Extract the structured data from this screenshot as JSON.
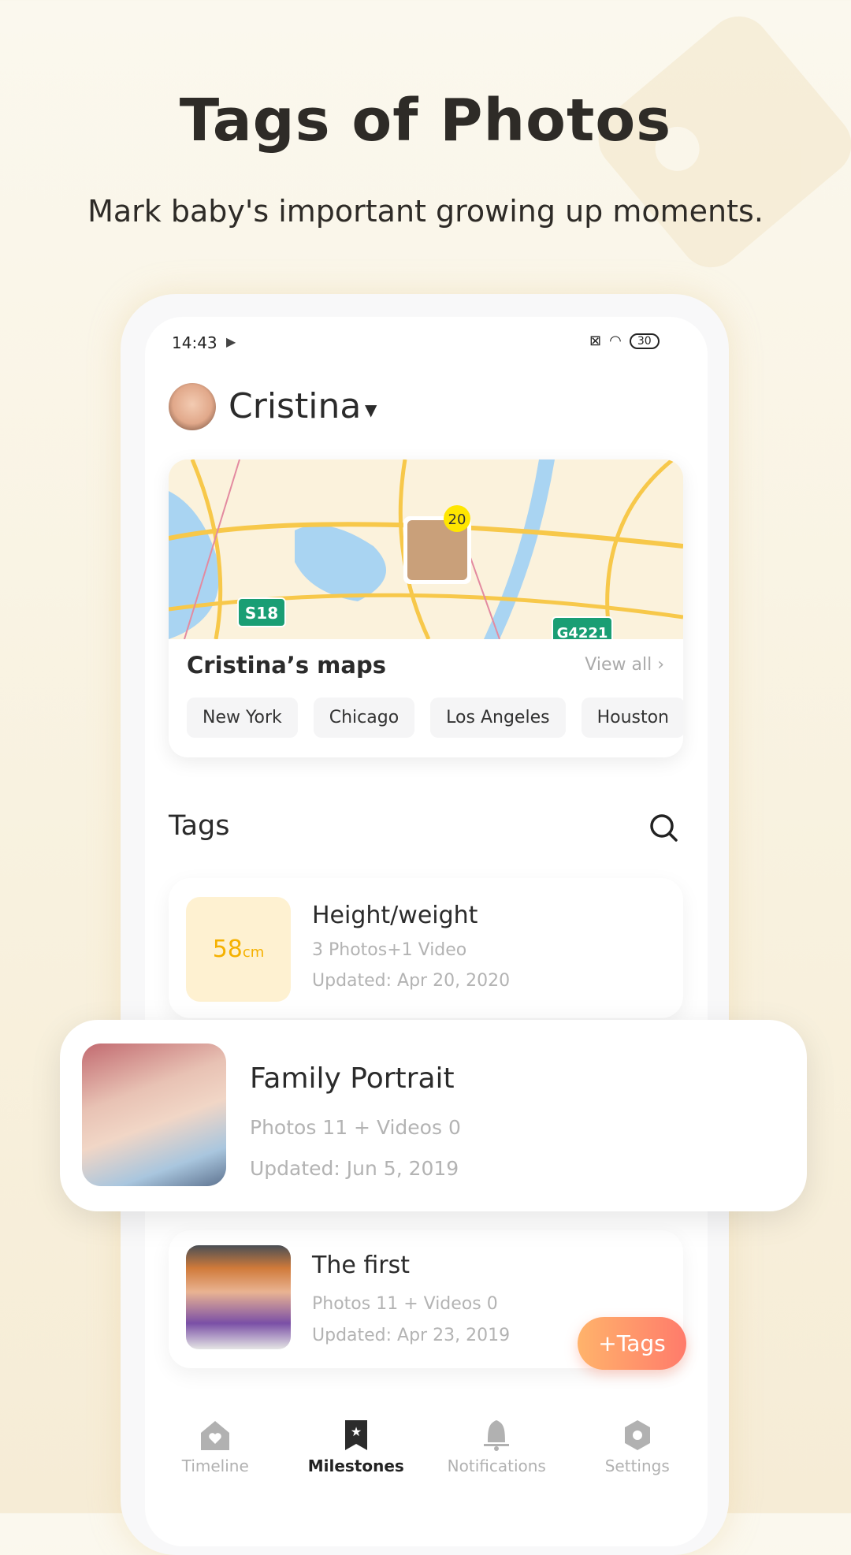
{
  "header": {
    "title": "Tags of Photos",
    "subtitle": "Mark baby's important growing up moments."
  },
  "status_bar": {
    "time": "14:43",
    "battery": "30"
  },
  "user": {
    "name": "Cristina"
  },
  "map_card": {
    "title": "Cristina’s maps",
    "view_all": "View all",
    "cluster_count": "20",
    "road_signs": [
      "S18",
      "G4221"
    ],
    "cities": [
      "New York",
      "Chicago",
      "Los Angeles",
      "Houston"
    ]
  },
  "tags": {
    "heading": "Tags",
    "items": [
      {
        "title": "Height/weight",
        "thumb_value": "58",
        "thumb_unit": "cm",
        "counts": "3 Photos+1 Video",
        "updated": "Updated: Apr 20, 2020"
      },
      {
        "title": "Family Portrait",
        "counts": "Photos 11 + Videos 0",
        "updated": "Updated: Jun 5, 2019"
      },
      {
        "title": "The first",
        "counts": "Photos 11 + Videos 0",
        "updated": "Updated: Apr 23, 2019"
      }
    ]
  },
  "add_button": "+Tags",
  "nav": [
    {
      "label": "Timeline",
      "icon": "home-heart-icon"
    },
    {
      "label": "Milestones",
      "icon": "bookmark-star-icon",
      "active": true
    },
    {
      "label": "Notifications",
      "icon": "bell-icon"
    },
    {
      "label": "Settings",
      "icon": "hexagon-gear-icon"
    }
  ],
  "colors": {
    "accent_start": "#ffb36b",
    "accent_end": "#ff7b6b",
    "highlight": "#f5b100"
  }
}
